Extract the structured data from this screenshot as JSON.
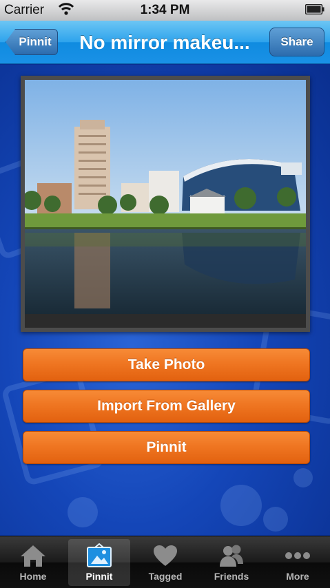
{
  "status_bar": {
    "carrier": "Carrier",
    "time": "1:34 PM"
  },
  "nav": {
    "back_label": "Pinnit",
    "title": "No mirror makeu...",
    "share_label": "Share"
  },
  "actions": {
    "take_photo": "Take Photo",
    "import_gallery": "Import From Gallery",
    "pinnit": "Pinnit"
  },
  "tabs": [
    {
      "label": "Home",
      "icon": "home-icon",
      "active": false
    },
    {
      "label": "Pinnit",
      "icon": "pinnit-photo-icon",
      "active": true
    },
    {
      "label": "Tagged",
      "icon": "heart-icon",
      "active": false
    },
    {
      "label": "Friends",
      "icon": "friends-icon",
      "active": false
    },
    {
      "label": "More",
      "icon": "more-icon",
      "active": false
    }
  ],
  "colors": {
    "nav_blue": "#1a91e6",
    "button_orange": "#ee7420",
    "background_blue": "#1446b8"
  }
}
